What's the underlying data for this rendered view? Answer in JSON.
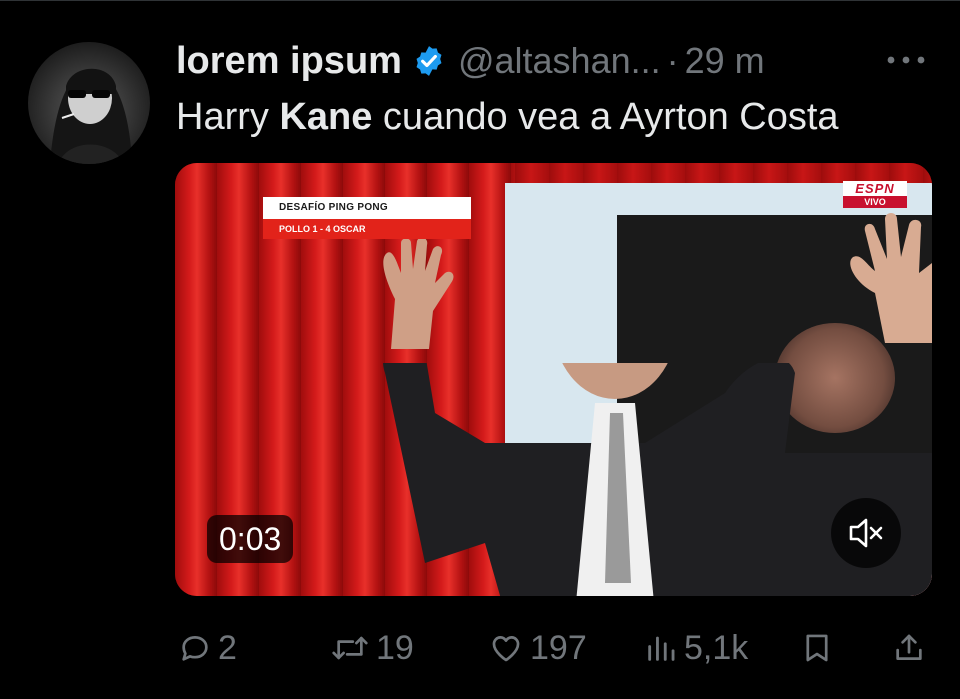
{
  "tweet": {
    "display_name": "lorem ipsum",
    "handle": "@altashan...",
    "separator": "·",
    "time": "29 m",
    "text_before": "Harry ",
    "text_bold": "Kane",
    "text_after": " cuando vea a Ayrton Costa"
  },
  "video": {
    "overlay_title": "DESAFÍO PING PONG",
    "overlay_score": "POLLO 1 - 4 OSCAR",
    "network_logo": "ESPN",
    "network_live": "VIVO",
    "elapsed": "0:03"
  },
  "actions": {
    "replies": "2",
    "retweets": "19",
    "likes": "197",
    "views": "5,1k"
  },
  "icons": {
    "avatar": "avatar-image",
    "verified": "verified-badge-icon",
    "more": "more-dots-icon",
    "mute": "volume-muted-icon",
    "reply": "reply-bubble-icon",
    "retweet": "retweet-arrows-icon",
    "like": "heart-icon",
    "views": "bar-chart-icon",
    "bookmark": "bookmark-icon",
    "share": "share-upload-icon"
  },
  "colors": {
    "background": "#000000",
    "primary_text": "#e7e9ea",
    "secondary_text": "#71767b",
    "verified_blue": "#1d9bf0"
  }
}
